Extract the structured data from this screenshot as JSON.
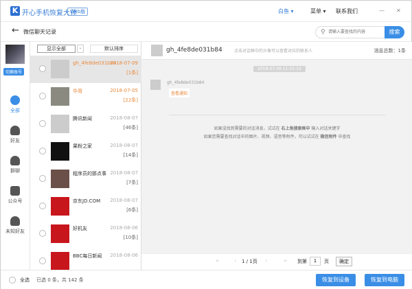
{
  "app": {
    "logo": "K",
    "title": "开心手机恢复大师",
    "badge": "Web版",
    "user": "白鱼 ▾",
    "menu": "菜单 ▾",
    "contact": "联系我们",
    "minimize": "—",
    "close": "✕"
  },
  "sub": {
    "back": "←",
    "title": "微信聊天记录",
    "search_placeholder": "请输入要查找的内容",
    "search_btn": "搜索"
  },
  "nav": {
    "switch": "切换账号",
    "items": [
      {
        "label": "全部"
      },
      {
        "label": "好友"
      },
      {
        "label": "群聊"
      },
      {
        "label": "公众号"
      },
      {
        "label": "未知好友"
      }
    ]
  },
  "filters": {
    "show": "显示全部",
    "sort": "默认排序"
  },
  "list": [
    {
      "name": "gh_4fe8de031b84",
      "date": "2018-07-09",
      "count": "[1条]"
    },
    {
      "name": "华哥",
      "date": "2018-07-05",
      "count": "[22条]"
    },
    {
      "name": "腾讯新闻",
      "date": "2018-08-07",
      "count": "[46条]"
    },
    {
      "name": "果粉之家",
      "date": "2018-08-07",
      "count": "[14条]"
    },
    {
      "name": "程序员的那点事",
      "date": "2018-08-07",
      "count": "[7条]"
    },
    {
      "name": "京东JD.COM",
      "date": "2018-08-07",
      "count": "[6条]"
    },
    {
      "name": "好机友",
      "date": "2018-08-06",
      "count": "[10条]"
    },
    {
      "name": "BBC每日新闻",
      "date": "2018-08-06",
      "count": ""
    }
  ],
  "chat": {
    "name": "gh_4fe8de031b84",
    "hint": "点击对话框中的头像可以查看对应的联系人",
    "total": "消息总数：1条",
    "time": "2018-07-09 11:25:15",
    "sender": "gh_4fe8de031b84",
    "message": "查看通知",
    "tip1a": "如果没找到需要的对话消息，试试在 ",
    "tip1b": "右上角搜索框中",
    "tip1c": " 输入对话关键字",
    "tip2a": "如果您需要查找对话中的图片、视频、语音等附件，可以试试在 ",
    "tip2b": "微信附件",
    "tip2c": " 中查找"
  },
  "pager": {
    "first": "«",
    "prev": "‹",
    "page": "1 / 1页",
    "next": "›",
    "last": "»",
    "goto": "到第",
    "value": "1",
    "unit": "页",
    "confirm": "确定"
  },
  "bottom": {
    "select_all": "全选",
    "summary": "已选 0 条，共 142 条",
    "restore_device": "恢复到设备",
    "restore_pc": "恢复到电脑"
  },
  "colors": {
    "accent": "#3a8ee6",
    "highlight": "#e8883a"
  }
}
